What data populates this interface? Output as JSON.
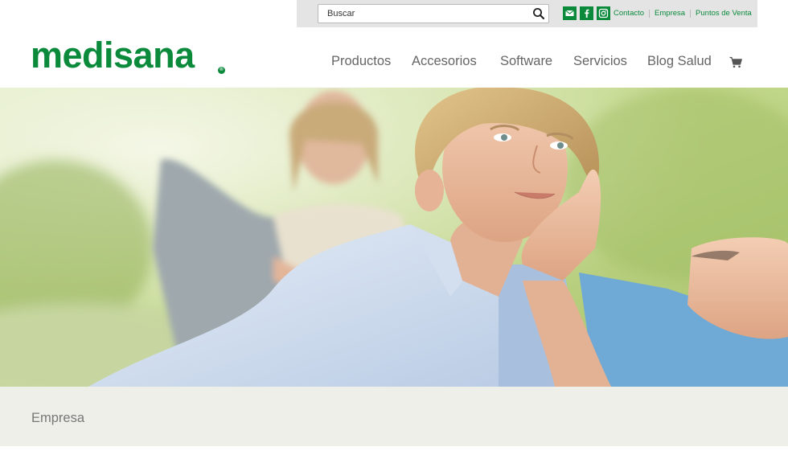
{
  "search": {
    "placeholder": "Buscar"
  },
  "social": {
    "icons": [
      "email-icon",
      "facebook-icon",
      "instagram-icon"
    ]
  },
  "utility_links": [
    "Contacto",
    "Empresa",
    "Puntos de Venta"
  ],
  "brand": {
    "logo_text": "medisana",
    "logo_mark": "®"
  },
  "nav": [
    "Productos",
    "Accesorios",
    "Software",
    "Servicios",
    "Blog Salud"
  ],
  "cart": {
    "icon": "shopping-cart-icon"
  },
  "hero": {
    "image": "family-relaxing-on-grass-photo"
  },
  "section": {
    "title": "Empresa"
  },
  "colors": {
    "brand_green": "#0b8a3c",
    "utility_bar": "#e4e4e4",
    "band": "#efefe9",
    "nav_text": "#666666"
  }
}
